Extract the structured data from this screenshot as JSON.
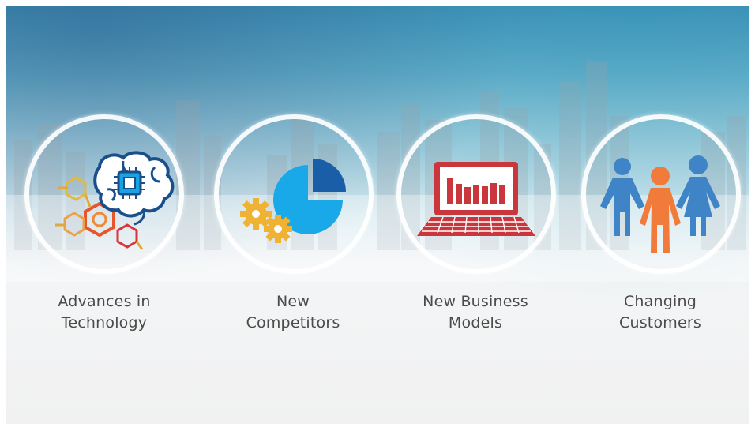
{
  "slide": {
    "items": [
      {
        "label_line1": "Advances in",
        "label_line2": "Technology",
        "icon": "brain-chip-icon"
      },
      {
        "label_line1": "New",
        "label_line2": "Competitors",
        "icon": "pie-chart-gears-icon"
      },
      {
        "label_line1": "New Business",
        "label_line2": "Models",
        "icon": "laptop-chart-icon"
      },
      {
        "label_line1": "Changing",
        "label_line2": "Customers",
        "icon": "people-icon"
      }
    ]
  },
  "colors": {
    "label_text": "#4a4a4a",
    "pie_blue": "#1aa9e8",
    "pie_dark": "#1b5ea8",
    "gear_gold": "#f0b233",
    "laptop_red": "#c9363c",
    "person_blue": "#3e84c6",
    "person_orange": "#f07b3a",
    "brain_outline": "#1a4f8a"
  }
}
